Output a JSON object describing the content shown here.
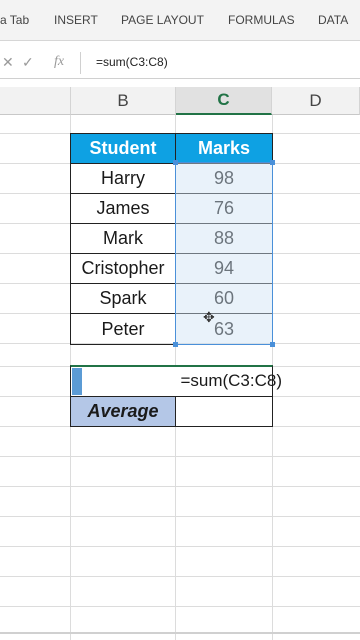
{
  "ribbon": {
    "tabs": [
      "a Tab",
      "INSERT",
      "PAGE LAYOUT",
      "FORMULAS",
      "DATA"
    ]
  },
  "formula_bar": {
    "cancel_icon": "x-icon",
    "enter_icon": "check-icon",
    "fx_label": "fx",
    "formula": "=sum(C3:C8)"
  },
  "columns": {
    "b": "B",
    "c": "C",
    "d": "D"
  },
  "table": {
    "headers": [
      "Student",
      "Marks"
    ],
    "rows": [
      [
        "Harry",
        "98"
      ],
      [
        "James",
        "76"
      ],
      [
        "Mark",
        "88"
      ],
      [
        "Cristopher",
        "94"
      ],
      [
        "Spark",
        "60"
      ],
      [
        "Peter",
        "63"
      ]
    ]
  },
  "summary": {
    "formula_display": "=sum(C3:C8)",
    "average_label": "Average",
    "average_value": ""
  },
  "colors": {
    "header_fill": "#0ea1e3",
    "accent": "#217346",
    "selection": "#4a90d9"
  }
}
